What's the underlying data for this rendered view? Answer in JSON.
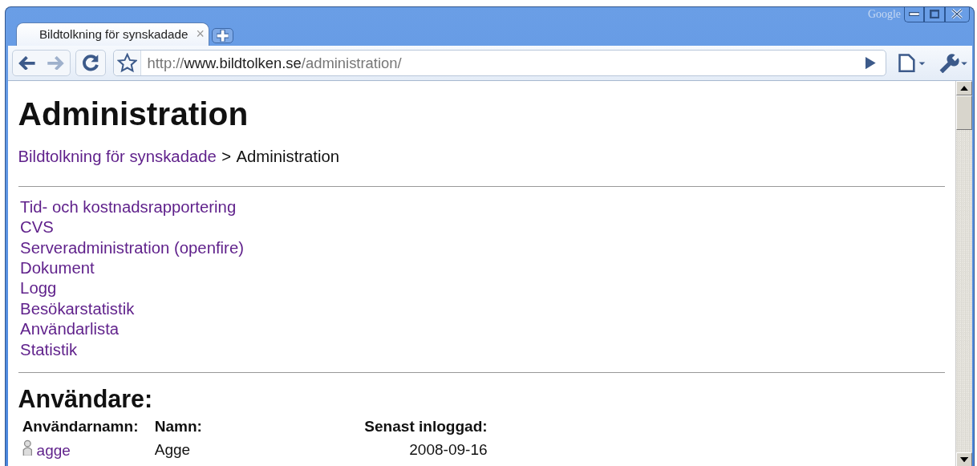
{
  "window": {
    "brand": "Google",
    "controls": [
      {
        "kind": "minimize"
      },
      {
        "kind": "maximize"
      },
      {
        "kind": "close"
      }
    ]
  },
  "tabs": [
    {
      "title": "Bildtolkning för synskadade",
      "close": "×",
      "selected": true
    }
  ],
  "toolbar": {
    "address": {
      "scheme": "http://",
      "host": "www.bildtolken.se",
      "path": "/administration/"
    }
  },
  "page": {
    "title": "Administration",
    "breadcrumb": {
      "link": "Bildtolkning för synskadade",
      "separator": ">",
      "current": "Administration"
    },
    "links": [
      "Tid- och kostnadsrapportering",
      "CVS",
      "Serveradministration (openfire)",
      "Dokument",
      "Logg",
      "Besökarstatistik",
      "Användarlista",
      "Statistik"
    ],
    "users": {
      "heading": "Användare:",
      "columns": [
        "Användarnamn:",
        "Namn:",
        "Senast inloggad:"
      ],
      "rows": [
        {
          "username": "agge",
          "name": "Agge",
          "last_login": "2008-09-16"
        }
      ]
    }
  }
}
